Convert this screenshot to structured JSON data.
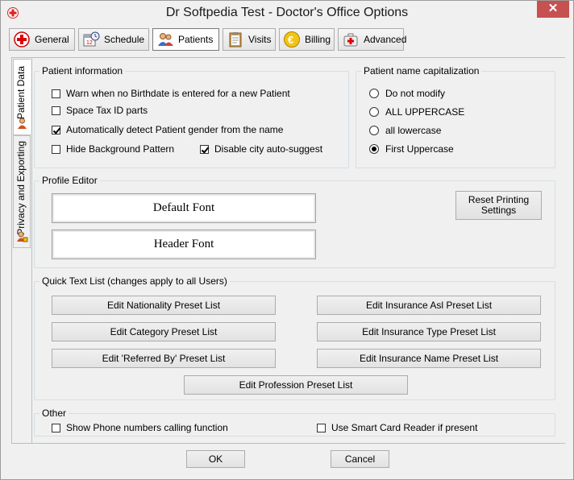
{
  "window": {
    "title": "Dr Softpedia Test - Doctor's Office Options",
    "close_glyph": "✕"
  },
  "toolbar": {
    "items": [
      {
        "label": "General",
        "icon": "red-cross-icon"
      },
      {
        "label": "Schedule",
        "icon": "calendar-clock-icon"
      },
      {
        "label": "Patients",
        "icon": "people-icon",
        "active": true
      },
      {
        "label": "Visits",
        "icon": "clipboard-icon"
      },
      {
        "label": "Billing",
        "icon": "euro-coin-icon"
      },
      {
        "label": "Advanced",
        "icon": "medical-kit-icon"
      }
    ]
  },
  "side_tabs": [
    {
      "label": "Patient Data",
      "icon": "person-icon",
      "active": true
    },
    {
      "label": "Privacy and Exporting",
      "icon": "person-lock-icon",
      "active": false
    }
  ],
  "patient_information": {
    "legend": "Patient information",
    "warn_birthdate": {
      "label": "Warn when no Birthdate is entered for a new Patient",
      "checked": false
    },
    "space_tax": {
      "label": "Space Tax ID parts",
      "checked": false
    },
    "detect_gender": {
      "label": "Automatically detect Patient gender from the name",
      "checked": true
    },
    "hide_background": {
      "label": "Hide Background Pattern",
      "checked": false
    },
    "disable_city": {
      "label": "Disable city auto-suggest",
      "checked": true
    }
  },
  "capitalization": {
    "legend": "Patient name capitalization",
    "options": [
      {
        "label": "Do not modify",
        "selected": false
      },
      {
        "label": "ALL UPPERCASE",
        "selected": false
      },
      {
        "label": "all lowercase",
        "selected": false
      },
      {
        "label": "First Uppercase",
        "selected": true
      }
    ]
  },
  "profile_editor": {
    "legend": "Profile Editor",
    "default_font": "Default Font",
    "header_font": "Header Font",
    "reset_printing": "Reset Printing Settings"
  },
  "quick_text": {
    "legend": "Quick Text List (changes apply to all Users)",
    "nationality": "Edit Nationality Preset List",
    "insurance_asl": "Edit Insurance Asl Preset List",
    "category": "Edit Category Preset List",
    "insurance_type": "Edit Insurance Type Preset List",
    "referred_by": "Edit 'Referred By' Preset List",
    "insurance_name": "Edit Insurance Name Preset List",
    "profession": "Edit Profession Preset List"
  },
  "other": {
    "legend": "Other",
    "phone_numbers": {
      "label": "Show Phone numbers calling function",
      "checked": false
    },
    "smart_card": {
      "label": "Use Smart Card Reader if present",
      "checked": false
    }
  },
  "footer": {
    "ok": "OK",
    "cancel": "Cancel"
  }
}
